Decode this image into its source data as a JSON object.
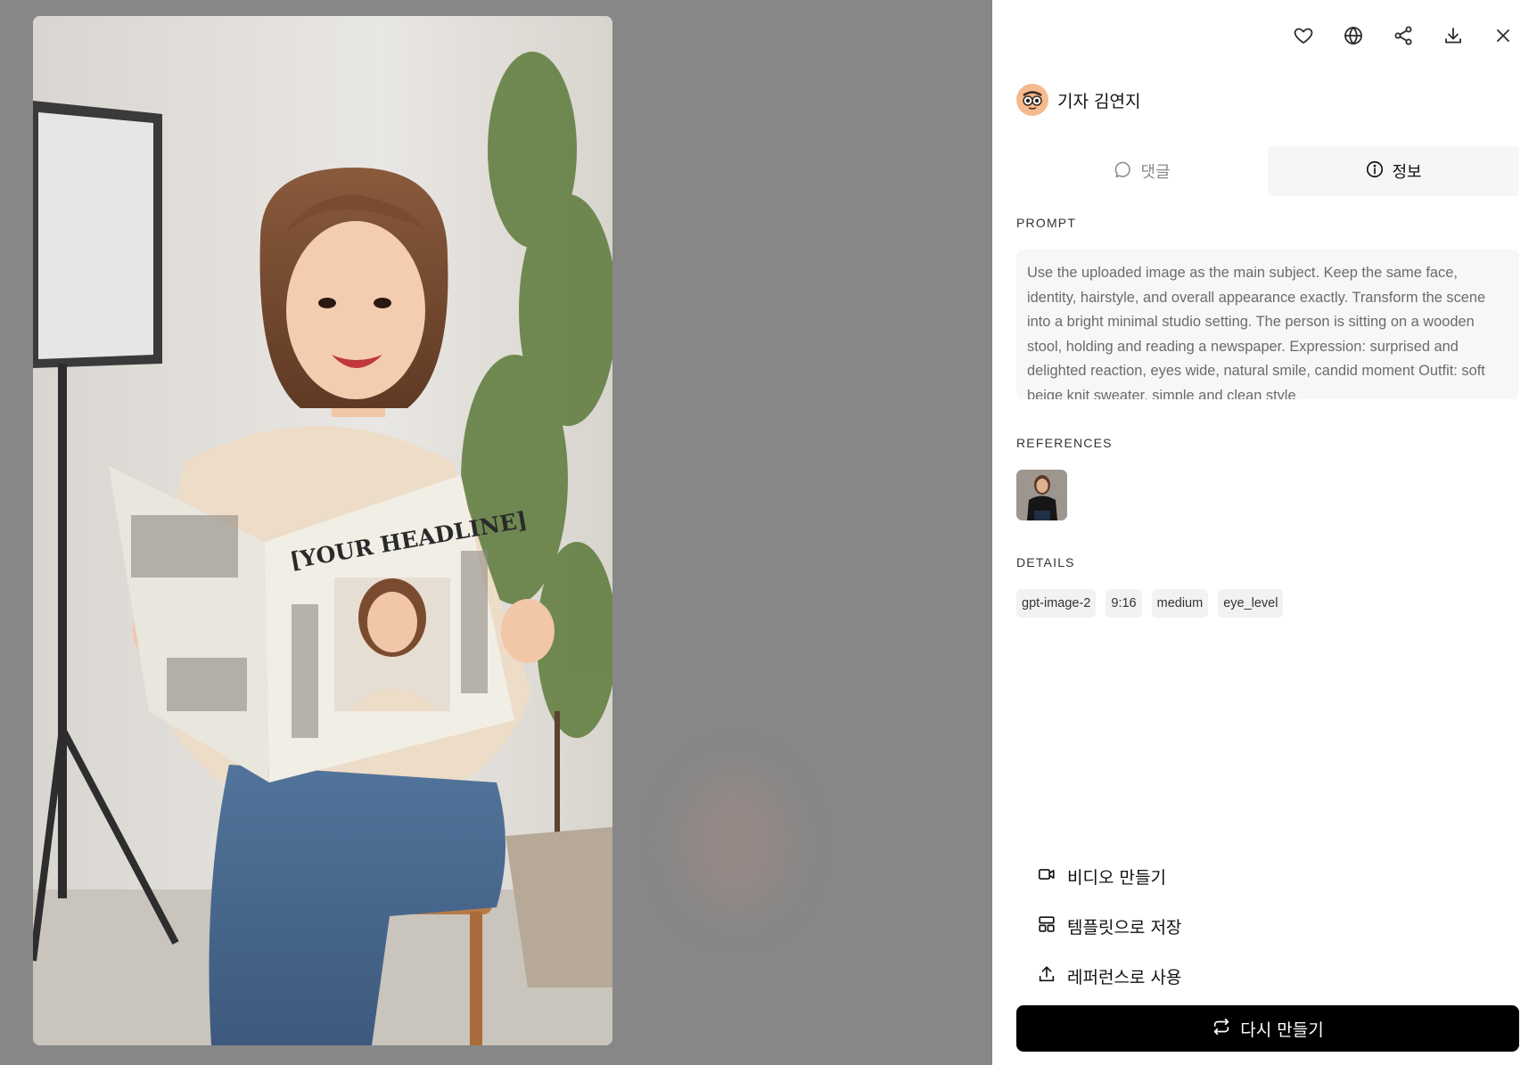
{
  "viewer": {
    "image_headline": "[YOUR HEADLINE]"
  },
  "toolbar": {
    "icons": [
      "heart-icon",
      "globe-icon",
      "share-icon",
      "download-icon",
      "close-icon"
    ]
  },
  "author": {
    "name": "기자 김연지"
  },
  "tabs": [
    {
      "label": "댓글",
      "icon": "comment-icon",
      "active": false
    },
    {
      "label": "정보",
      "icon": "info-icon",
      "active": true
    }
  ],
  "prompt": {
    "heading": "PROMPT",
    "text": "Use the uploaded image as the main subject. Keep the same face, identity, hairstyle, and overall appearance exactly. Transform the scene into a bright minimal studio setting. The person is sitting on a wooden stool, holding and reading a newspaper. Expression: surprised and delighted reaction, eyes wide, natural smile, candid moment Outfit: soft beige knit sweater, simple and clean style"
  },
  "references": {
    "heading": "REFERENCES"
  },
  "details": {
    "heading": "DETAILS",
    "chips": [
      "gpt-image-2",
      "9:16",
      "medium",
      "eye_level"
    ]
  },
  "actions": [
    {
      "label": "비디오 만들기",
      "icon": "video-icon"
    },
    {
      "label": "템플릿으로 저장",
      "icon": "template-icon"
    },
    {
      "label": "레퍼런스로 사용",
      "icon": "upload-icon"
    }
  ],
  "primary": {
    "label": "다시 만들기",
    "icon": "repeat-icon"
  }
}
